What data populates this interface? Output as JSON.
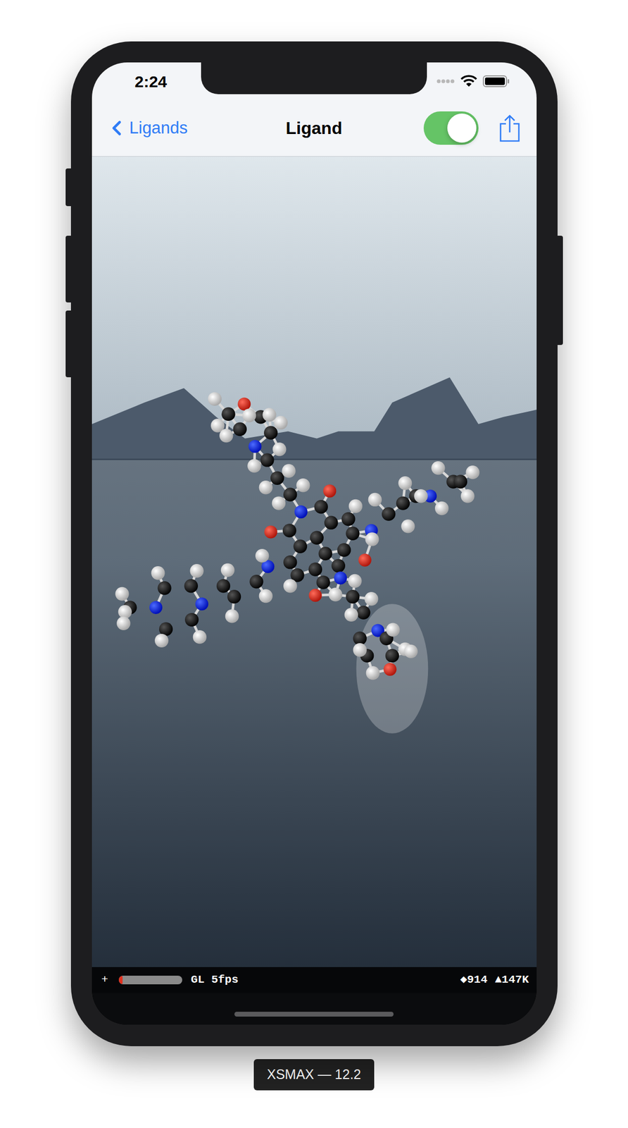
{
  "status_bar": {
    "time": "2:24"
  },
  "nav": {
    "back": "Ligands",
    "title": "Ligand",
    "toggle": {
      "on": true
    }
  },
  "stats": {
    "add": "+",
    "level": 0.06,
    "renderer": "GL 5fps",
    "nodes": "◆914",
    "triangles": "▲147K"
  },
  "device_label": "XSMAX — 12.2"
}
